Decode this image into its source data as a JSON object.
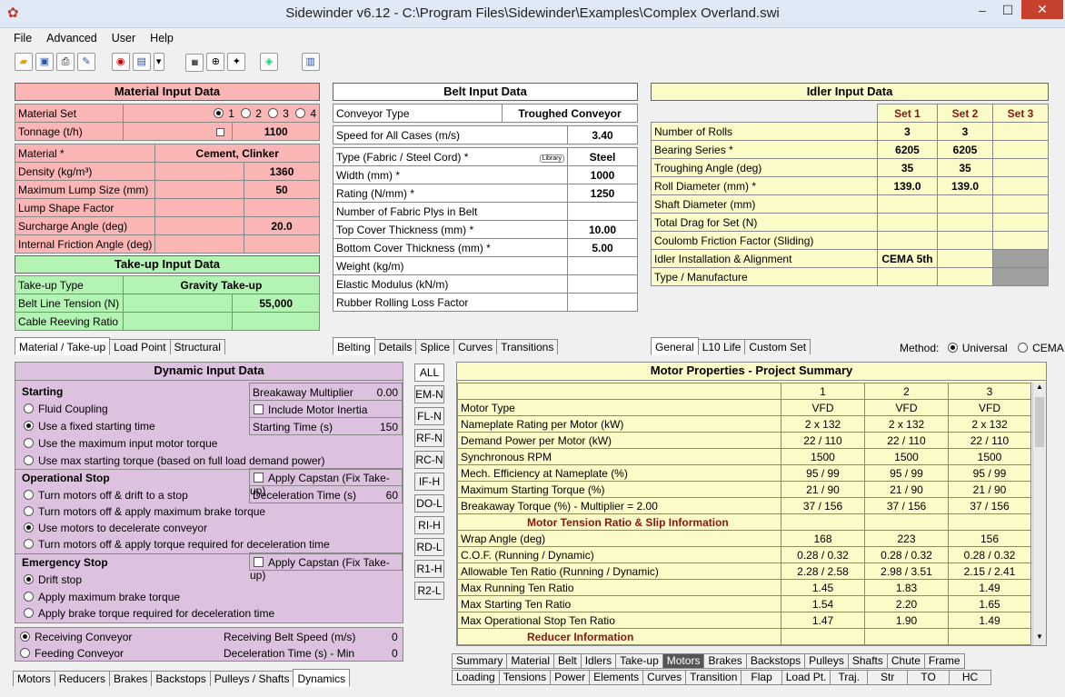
{
  "window": {
    "title": "Sidewinder v6.12 - C:\\Program Files\\Sidewinder\\Examples\\Complex Overland.swi",
    "minimize": "–",
    "maximize": "☐",
    "close": "✕"
  },
  "menu": [
    "File",
    "Advanced",
    "User",
    "Help"
  ],
  "material": {
    "header": "Material Input Data",
    "rows": [
      {
        "label": "Material Set",
        "value": ""
      },
      {
        "label": "Tonnage (t/h)",
        "value": "1100"
      },
      {
        "label": "Material *",
        "value": "Cement, Clinker"
      },
      {
        "label": "Density (kg/m³)",
        "value": "1360"
      },
      {
        "label": "Maximum Lump Size (mm)",
        "value": "50"
      },
      {
        "label": "Lump Shape Factor",
        "value": ""
      },
      {
        "label": "Surcharge Angle (deg)",
        "value": "20.0"
      },
      {
        "label": "Internal Friction Angle (deg)",
        "value": ""
      }
    ],
    "set_options": [
      "1",
      "2",
      "3",
      "4"
    ]
  },
  "takeup": {
    "header": "Take-up Input Data",
    "rows": [
      {
        "label": "Take-up Type",
        "value": "Gravity Take-up"
      },
      {
        "label": "Belt Line Tension (N)",
        "value": "55,000"
      },
      {
        "label": "Cable Reeving Ratio",
        "value": ""
      }
    ]
  },
  "left_tabs": [
    "Material / Take-up",
    "Load Point",
    "Structural"
  ],
  "belt": {
    "header": "Belt Input Data",
    "rows": [
      {
        "label": "Conveyor Type",
        "value": "Troughed Conveyor"
      },
      {
        "label": "Speed for All Cases (m/s)",
        "value": "3.40"
      },
      {
        "label": "Type (Fabric / Steel Cord) *",
        "value": "Steel"
      },
      {
        "label": "Width (mm) *",
        "value": "1000"
      },
      {
        "label": "Rating (N/mm) *",
        "value": "1250"
      },
      {
        "label": "Number of Fabric Plys in Belt",
        "value": ""
      },
      {
        "label": "Top Cover Thickness (mm) *",
        "value": "10.00"
      },
      {
        "label": "Bottom Cover Thickness (mm) *",
        "value": "5.00"
      },
      {
        "label": "Weight (kg/m)",
        "value": ""
      },
      {
        "label": "Elastic Modulus (kN/m)",
        "value": ""
      },
      {
        "label": "Rubber Rolling Loss Factor",
        "value": ""
      }
    ],
    "library": "Library"
  },
  "belt_tabs": [
    "Belting",
    "Details",
    "Splice",
    "Curves",
    "Transitions"
  ],
  "idler": {
    "header": "Idler Input Data",
    "sets": [
      "Set 1",
      "Set 2",
      "Set 3"
    ],
    "rows": [
      {
        "label": "Number of Rolls",
        "v": [
          "3",
          "3",
          ""
        ]
      },
      {
        "label": "Bearing Series *",
        "v": [
          "6205",
          "6205",
          ""
        ]
      },
      {
        "label": "Troughing Angle (deg)",
        "v": [
          "35",
          "35",
          ""
        ]
      },
      {
        "label": "Roll Diameter (mm) *",
        "v": [
          "139.0",
          "139.0",
          ""
        ]
      },
      {
        "label": "Shaft Diameter (mm)",
        "v": [
          "",
          "",
          ""
        ]
      },
      {
        "label": "Total Drag for Set (N)",
        "v": [
          "",
          "",
          ""
        ]
      },
      {
        "label": "Coulomb Friction Factor (Sliding)",
        "v": [
          "",
          "",
          ""
        ]
      },
      {
        "label": "Idler Installation & Alignment",
        "v": [
          "CEMA 5th",
          "",
          ""
        ]
      },
      {
        "label": "Type / Manufacture",
        "v": [
          "",
          "",
          ""
        ]
      }
    ]
  },
  "idler_tabs": [
    "General",
    "L10 Life",
    "Custom Set"
  ],
  "method": {
    "label": "Method:",
    "options": [
      "Universal",
      "CEMA"
    ]
  },
  "dynamic": {
    "header": "Dynamic Input Data",
    "starting_title": "Starting",
    "starting": [
      "Fluid Coupling",
      "Use a fixed starting time",
      "Use the maximum input motor torque",
      "Use max starting torque (based on full load demand power)"
    ],
    "breakaway_label": "Breakaway Multiplier",
    "breakaway_value": "0.00",
    "include_inertia": "Include Motor Inertia",
    "start_time_label": "Starting Time (s)",
    "start_time_value": "150",
    "op_title": "Operational Stop",
    "op": [
      "Turn motors off & drift to a stop",
      "Turn motors off & apply maximum brake torque",
      "Use motors to decelerate conveyor",
      "Turn motors off & apply torque required for deceleration time"
    ],
    "capstan": "Apply Capstan (Fix Take-up)",
    "decel_label": "Deceleration Time (s)",
    "decel_value": "60",
    "em_title": "Emergency Stop",
    "em": [
      "Drift stop",
      "Apply maximum brake torque",
      "Apply brake torque required for deceleration time"
    ],
    "capstan2": "Apply Capstan (Fix Take-up)",
    "recv": "Receiving Conveyor",
    "feed": "Feeding Conveyor",
    "recv_speed_label": "Receiving Belt Speed (m/s)",
    "recv_speed_value": "0",
    "decel_min_label": "Deceleration Time (s) - Min",
    "decel_min_value": "0"
  },
  "dyn_tabs": [
    "Motors",
    "Reducers",
    "Brakes",
    "Backstops",
    "Pulleys / Shafts",
    "Dynamics"
  ],
  "side_tabs": [
    "ALL",
    "EM-N",
    "FL-N",
    "RF-N",
    "RC-N",
    "IF-H",
    "DO-L",
    "RI-H",
    "RD-L",
    "R1-H",
    "R2-L"
  ],
  "motor": {
    "header": "Motor Properties - Project Summary",
    "cols": [
      "1",
      "2",
      "3"
    ],
    "rows": [
      {
        "label": "Motor Type",
        "v": [
          "VFD",
          "VFD",
          "VFD"
        ]
      },
      {
        "label": "Nameplate Rating per Motor (kW)",
        "v": [
          "2 x 132",
          "2 x 132",
          "2 x 132"
        ]
      },
      {
        "label": "Demand Power per Motor (kW)",
        "v": [
          "22 / 110",
          "22 / 110",
          "22 / 110"
        ]
      },
      {
        "label": "Synchronous RPM",
        "v": [
          "1500",
          "1500",
          "1500"
        ]
      },
      {
        "label": "Mech. Efficiency at Nameplate (%)",
        "v": [
          "95 / 99",
          "95 / 99",
          "95 / 99"
        ]
      },
      {
        "label": "Maximum Starting Torque (%)",
        "v": [
          "21 / 90",
          "21 / 90",
          "21 / 90"
        ]
      },
      {
        "label": "Breakaway Torque (%) - Multiplier = 2.00",
        "v": [
          "37 / 156",
          "37 / 156",
          "37 / 156"
        ]
      },
      {
        "section": "Motor Tension Ratio & Slip Information"
      },
      {
        "label": "Wrap Angle (deg)",
        "v": [
          "168",
          "223",
          "156"
        ]
      },
      {
        "label": "C.O.F. (Running / Dynamic)",
        "v": [
          "0.28 / 0.32",
          "0.28 / 0.32",
          "0.28 / 0.32"
        ]
      },
      {
        "label": "Allowable Ten Ratio (Running / Dynamic)",
        "v": [
          "2.28 / 2.58",
          "2.98 / 3.51",
          "2.15 / 2.41"
        ]
      },
      {
        "label": "Max Running Ten Ratio",
        "v": [
          "1.45",
          "1.83",
          "1.49"
        ]
      },
      {
        "label": "Max Starting Ten Ratio",
        "v": [
          "1.54",
          "2.20",
          "1.65"
        ]
      },
      {
        "label": "Max Operational Stop Ten Ratio",
        "v": [
          "1.47",
          "1.90",
          "1.49"
        ]
      },
      {
        "section": "Reducer Information"
      }
    ]
  },
  "bottom_tabs1": [
    "Summary",
    "Material",
    "Belt",
    "Idlers",
    "Take-up",
    "Motors",
    "Brakes",
    "Backstops",
    "Pulleys",
    "Shafts",
    "Chute",
    "Frame"
  ],
  "bottom_tabs2": [
    "Loading",
    "Tensions",
    "Power",
    "Elements",
    "Curves",
    "Transition",
    "Flap",
    "Load Pt.",
    "Traj.",
    "Str",
    "TO",
    "HC"
  ],
  "colors": {
    "pink": "#fbb5b5",
    "green": "#b3f3b3",
    "yellow": "#fbfbc7",
    "purple": "#dcc2de"
  }
}
